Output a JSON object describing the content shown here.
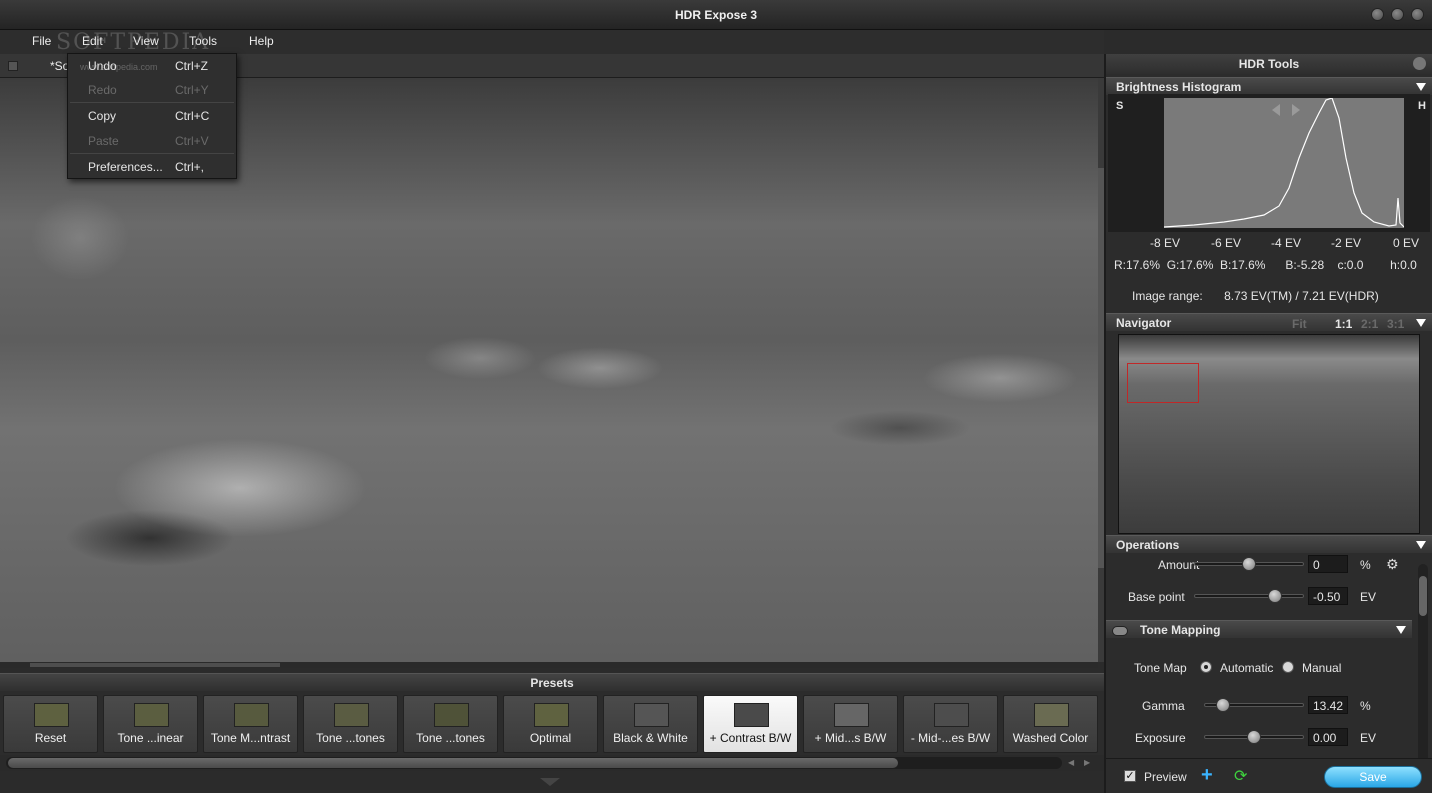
{
  "window": {
    "title": "HDR Expose 3"
  },
  "menu": {
    "file": "File",
    "edit": "Edit",
    "view": "View",
    "tools": "Tools",
    "help": "Help"
  },
  "watermark": {
    "brand": "SOFTPEDIA",
    "url": "www.softpedia.com"
  },
  "document_tab": {
    "label": "*So"
  },
  "edit_menu": {
    "items": [
      {
        "label": "Undo",
        "shortcut": "Ctrl+Z",
        "enabled": true
      },
      {
        "label": "Redo",
        "shortcut": "Ctrl+Y",
        "enabled": false
      },
      {
        "label": "Copy",
        "shortcut": "Ctrl+C",
        "enabled": true
      },
      {
        "label": "Paste",
        "shortcut": "Ctrl+V",
        "enabled": false
      },
      {
        "label": "Preferences...",
        "shortcut": "Ctrl+,",
        "enabled": true
      }
    ]
  },
  "presets": {
    "header": "Presets",
    "items": [
      {
        "label": "Reset",
        "thumb": "#5e6140"
      },
      {
        "label": "Tone ...inear",
        "thumb": "#5b5e40"
      },
      {
        "label": "Tone M...ntrast",
        "thumb": "#575a3e"
      },
      {
        "label": "Tone ...tones",
        "thumb": "#5a5c42"
      },
      {
        "label": "Tone ...tones",
        "thumb": "#4f5238"
      },
      {
        "label": "Optimal",
        "thumb": "#5f6240"
      },
      {
        "label": "Black & White",
        "thumb": "#555555"
      },
      {
        "label": "+ Contrast B/W",
        "thumb": "#4a4a4a",
        "selected": true
      },
      {
        "label": "+ Mid...s B/W",
        "thumb": "#666666"
      },
      {
        "label": "- Mid-...es B/W",
        "thumb": "#4d4d4d"
      },
      {
        "label": "Washed Color",
        "thumb": "#6a6b52"
      }
    ]
  },
  "hdr_tools": {
    "title": "HDR Tools",
    "histogram": {
      "title": "Brightness Histogram",
      "shadow_label": "S",
      "highlight_label": "H",
      "ev_ticks": [
        "-8 EV",
        "-6 EV",
        "-4 EV",
        "-2 EV",
        "0 EV"
      ],
      "stats": "R:17.6%  G:17.6%  B:17.6%      B:-5.28    c:0.0        h:0.0",
      "image_range_label": "Image range:",
      "image_range_value": "8.73 EV(TM) / 7.21 EV(HDR)"
    },
    "navigator": {
      "title": "Navigator",
      "zoom_fit": "Fit",
      "zoom_1_1": "1:1",
      "zoom_2_1": "2:1",
      "zoom_3_1": "3:1"
    },
    "operations": {
      "title": "Operations",
      "amount_label": "Amount",
      "amount_value": "0",
      "amount_unit": "%",
      "amount_level": 0.5,
      "basepoint_label": "Base point",
      "basepoint_value": "-0.50",
      "basepoint_unit": "EV",
      "basepoint_level": 0.78
    },
    "tone_mapping": {
      "title": "Tone Mapping",
      "tonemap_label": "Tone Map",
      "automatic_label": "Automatic",
      "manual_label": "Manual",
      "gamma_label": "Gamma",
      "gamma_value": "13.42",
      "gamma_unit": "%",
      "gamma_level": 0.13,
      "exposure_label": "Exposure",
      "exposure_value": "0.00",
      "exposure_unit": "EV",
      "exposure_level": 0.5
    },
    "footer": {
      "preview_label": "Preview",
      "save_label": "Save"
    }
  }
}
